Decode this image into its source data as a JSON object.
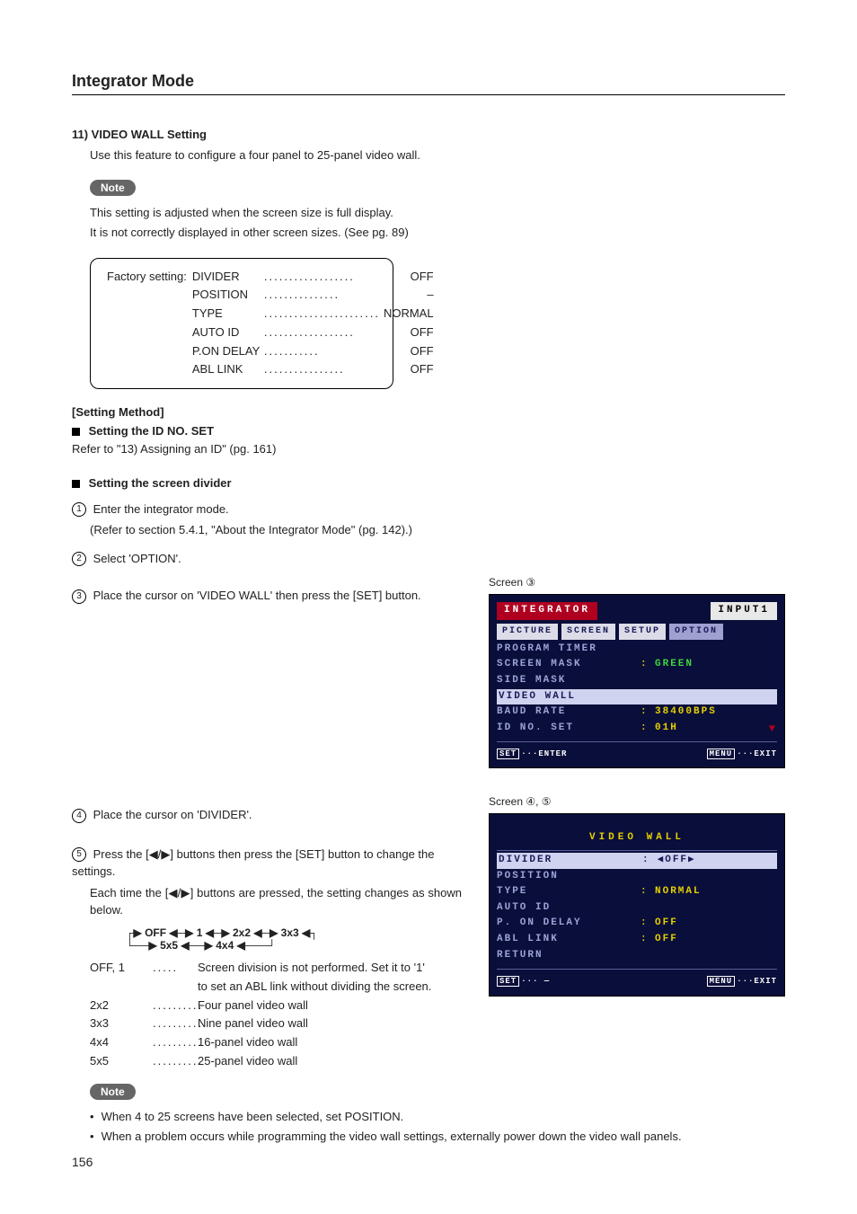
{
  "section_title": "Integrator Mode",
  "section": {
    "number_title": "11) VIDEO WALL Setting",
    "intro": "Use this feature to configure a four panel to 25-panel video wall."
  },
  "note1": {
    "label": "Note",
    "line1": "This setting is adjusted when the screen size is full display.",
    "line2": "It is not correctly displayed in other screen sizes. (See pg. 89)"
  },
  "factory": {
    "prefix": "Factory setting:",
    "rows": [
      {
        "k": "DIVIDER",
        "v": "OFF"
      },
      {
        "k": "POSITION",
        "v": "–"
      },
      {
        "k": "TYPE",
        "v": "NORMAL"
      },
      {
        "k": "AUTO ID",
        "v": "OFF"
      },
      {
        "k": "P.ON DELAY",
        "v": "OFF"
      },
      {
        "k": "ABL LINK",
        "v": "OFF"
      }
    ]
  },
  "setting_method": "[Setting Method]",
  "idno": {
    "heading": "Setting the ID NO. SET",
    "text": "Refer to \"13) Assigning an ID\" (pg. 161)"
  },
  "divider_heading": "Setting the screen divider",
  "steps": {
    "s1a": "Enter the integrator mode.",
    "s1b": "(Refer to section 5.4.1, \"About the Integrator Mode\" (pg. 142).)",
    "s2": "Select 'OPTION'.",
    "s3": "Place the cursor on 'VIDEO WALL' then press the [SET] button.",
    "s4": "Place the cursor on 'DIVIDER'.",
    "s5a": "Press the [◀/▶] buttons then press the [SET] button to change the settings.",
    "s5b": "Each time the [◀/▶] buttons are pressed, the setting changes as shown below."
  },
  "screen3_label": "Screen ③",
  "osd1": {
    "title_left": "INTEGRATOR",
    "title_right": "INPUT1",
    "tabs": [
      "PICTURE",
      "SCREEN",
      "SETUP",
      "OPTION"
    ],
    "rows": [
      {
        "label": "PROGRAM TIMER",
        "val": ""
      },
      {
        "label": "SCREEN MASK",
        "val": "GREEN",
        "hl": false,
        "green": true
      },
      {
        "label": "SIDE MASK",
        "val": ""
      },
      {
        "label": "VIDEO WALL",
        "val": "",
        "hl": true
      },
      {
        "label": "BAUD RATE",
        "val": "38400BPS"
      },
      {
        "label": "ID NO. SET",
        "val": "01H"
      }
    ],
    "foot_left": "SET···ENTER",
    "foot_right": "MENU···EXIT"
  },
  "screen45_label": "Screen ④, ⑤",
  "osd2": {
    "title": "VIDEO WALL",
    "rows": [
      {
        "label": "DIVIDER",
        "val": "◀OFF▶",
        "hl": true,
        "white": true
      },
      {
        "label": "POSITION",
        "val": ""
      },
      {
        "label": "TYPE",
        "val": "NORMAL"
      },
      {
        "label": "AUTO ID",
        "val": ""
      },
      {
        "label": "P. ON DELAY",
        "val": "OFF"
      },
      {
        "label": "ABL LINK",
        "val": "OFF"
      },
      {
        "label": " RETURN",
        "val": ""
      }
    ],
    "foot_left": "SET··· —",
    "foot_right": "MENU···EXIT"
  },
  "cycle": {
    "line1": "OFF ◀─▶ 1 ◀─▶ 2x2 ◀─▶ 3x3",
    "line2": "5x5 ◀──▶ 4x4"
  },
  "defs": {
    "off1": {
      "k": "OFF, 1",
      "v1": "Screen division is not performed. Set it to '1'",
      "v2": "to set an ABL link without dividing the screen."
    },
    "r2": {
      "k": "2x2",
      "v": "Four panel video wall"
    },
    "r3": {
      "k": "3x3",
      "v": "Nine panel video wall"
    },
    "r4": {
      "k": "4x4",
      "v": "16-panel video wall"
    },
    "r5": {
      "k": "5x5",
      "v": "25-panel video wall"
    }
  },
  "note2": {
    "label": "Note",
    "b1": "When 4 to 25 screens have been selected, set POSITION.",
    "b2": "When a problem occurs while programming the video wall settings, externally power down the video wall panels."
  },
  "page_number": "156"
}
